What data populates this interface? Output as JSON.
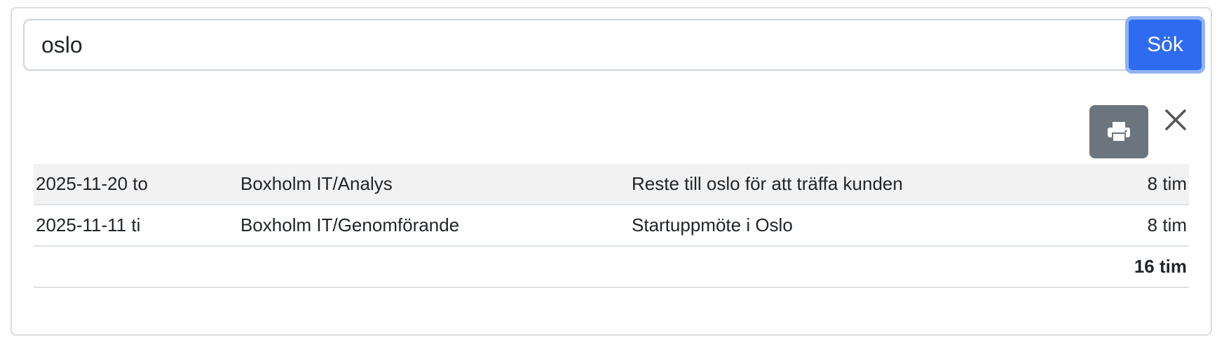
{
  "search": {
    "value": "oslo",
    "button_label": "Sök"
  },
  "toolbar": {
    "print_icon": "printer-icon",
    "close_icon": "close-icon"
  },
  "rows": [
    {
      "date": "2025-11-20 to",
      "project": "Boxholm IT/Analys",
      "description": "Reste till oslo för att träffa kunden",
      "hours": "8 tim"
    },
    {
      "date": "2025-11-11 ti",
      "project": "Boxholm IT/Genomförande",
      "description": "Startuppmöte i Oslo",
      "hours": "8 tim"
    }
  ],
  "total": {
    "hours": "16 tim"
  },
  "colors": {
    "primary": "#2f6bf0",
    "secondary": "#6c757d",
    "stripe": "#f2f2f2"
  }
}
